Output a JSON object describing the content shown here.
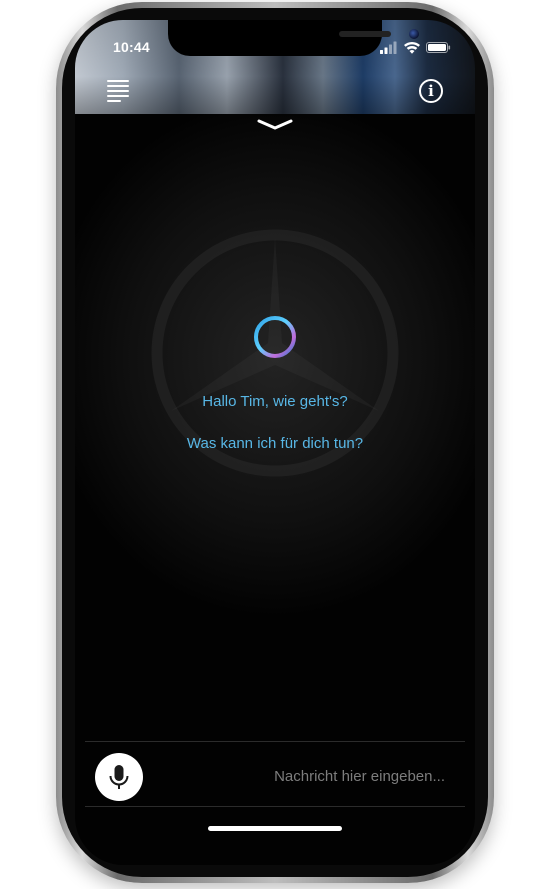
{
  "status_bar": {
    "time": "10:44",
    "icons": [
      "cellular-signal-icon",
      "wifi-icon",
      "battery-icon"
    ]
  },
  "header": {
    "menu_icon": "menu-icon",
    "info_icon": "info-icon",
    "info_glyph": "i",
    "collapse_icon": "chevron-down-icon"
  },
  "assistant": {
    "greeting": "Hallo Tim, wie geht's?",
    "prompt": "Was kann ich für dich tun?",
    "indicator_icon": "assistant-ring-icon",
    "background_logo": "mercedes-star-logo"
  },
  "composer": {
    "mic_icon": "microphone-icon",
    "placeholder": "Nachricht hier eingeben..."
  },
  "colors": {
    "accent_text": "#58b7e6",
    "background": "#0a0a0a",
    "mic_button": "#ffffff"
  }
}
